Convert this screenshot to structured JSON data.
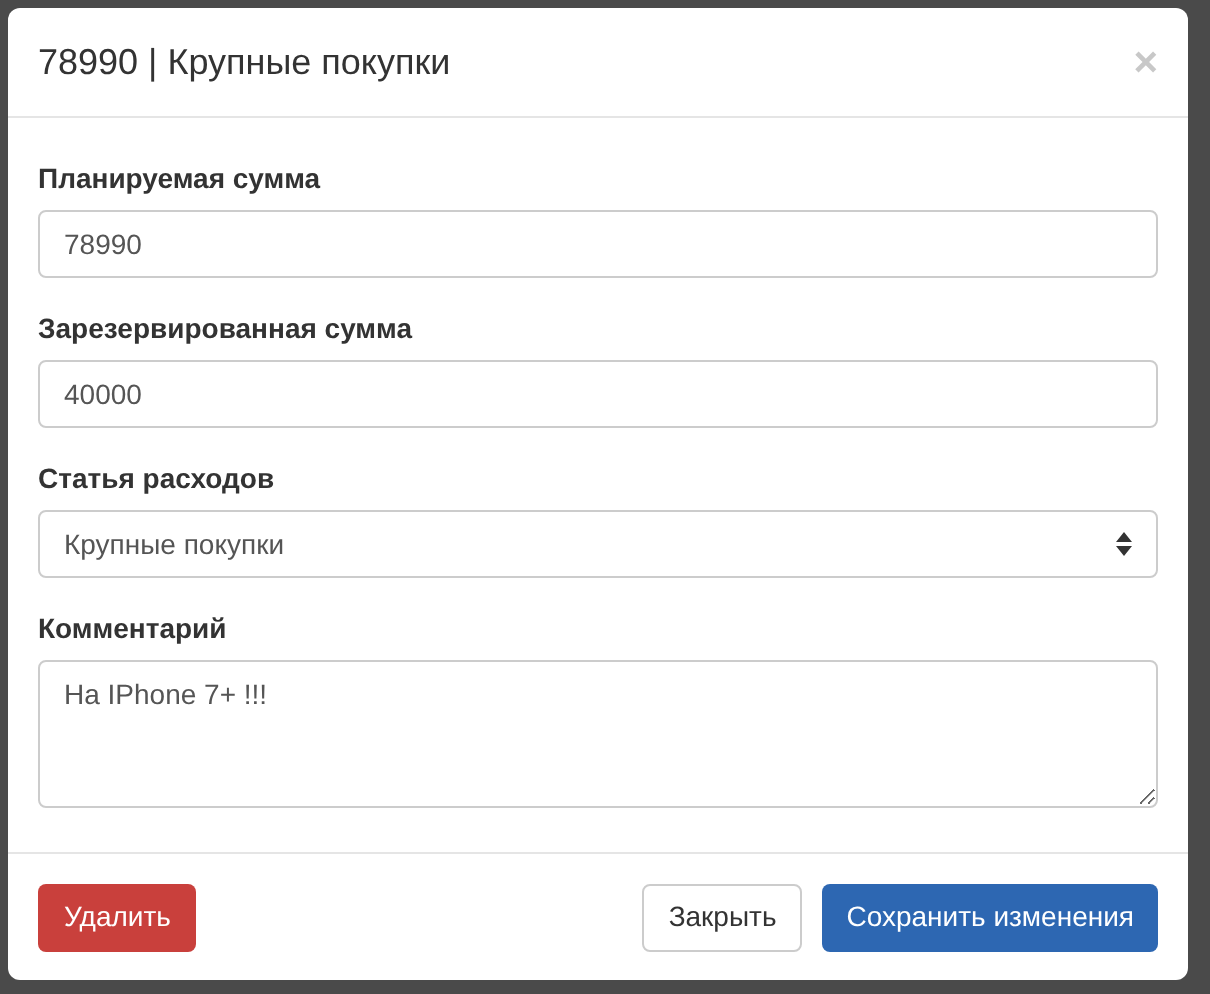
{
  "modal": {
    "title": "78990 | Крупные покупки",
    "close": "×"
  },
  "fields": [
    {
      "kind": "input",
      "label": "Планируемая сумма",
      "value": "78990"
    },
    {
      "kind": "input",
      "label": "Зарезервированная сумма",
      "value": "40000"
    },
    {
      "kind": "select",
      "label": "Статья расходов",
      "value": "Крупные покупки"
    },
    {
      "kind": "textarea",
      "label": "Комментарий",
      "value": "На IPhone 7+ !!!"
    }
  ],
  "footer": {
    "delete": "Удалить",
    "close": "Закрыть",
    "save": "Сохранить изменения"
  }
}
